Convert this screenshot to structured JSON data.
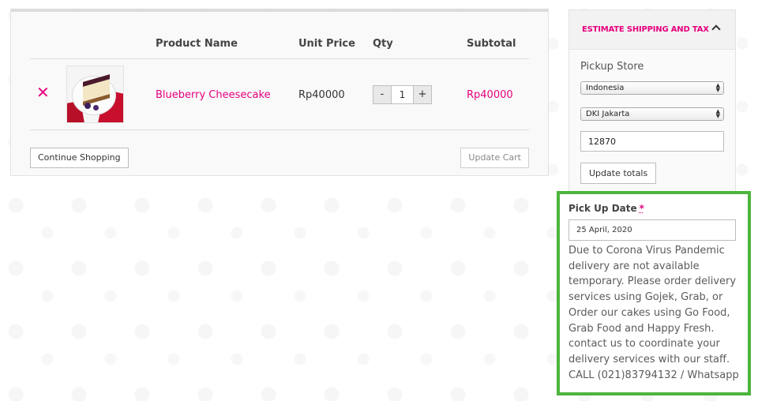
{
  "cart": {
    "headers": {
      "product_name": "Product Name",
      "unit_price": "Unit Price",
      "qty": "Qty",
      "subtotal": "Subtotal"
    },
    "items": [
      {
        "remove_icon": "close-icon",
        "product_name": "Blueberry Cheesecake",
        "unit_price": "Rp40000",
        "qty_minus": "-",
        "qty_value": "1",
        "qty_plus": "+",
        "subtotal": "Rp40000"
      }
    ],
    "continue_label": "Continue Shopping",
    "update_label": "Update Cart"
  },
  "estimate": {
    "title": "ESTIMATE SHIPPING AND TAX",
    "toggle_icon": "chevron-up-icon",
    "pickup_label": "Pickup Store",
    "country": "Indonesia",
    "region": "DKI Jakarta",
    "postcode": "12870",
    "update_totals_label": "Update totals"
  },
  "pickup": {
    "label": "Pick Up Date",
    "required_mark": "*",
    "date_value": "25 April, 2020",
    "notice": "Due to Corona Virus Pandemic delivery are not available temporary. Please order delivery services using Gojek, Grab, or Order our cakes using Go Food, Grab Food and Happy Fresh. contact us to coordinate your delivery services with our staff. CALL (021)83794132 / Whatsapp"
  },
  "colors": {
    "accent": "#e6007e",
    "highlight_border": "#4db43d"
  }
}
